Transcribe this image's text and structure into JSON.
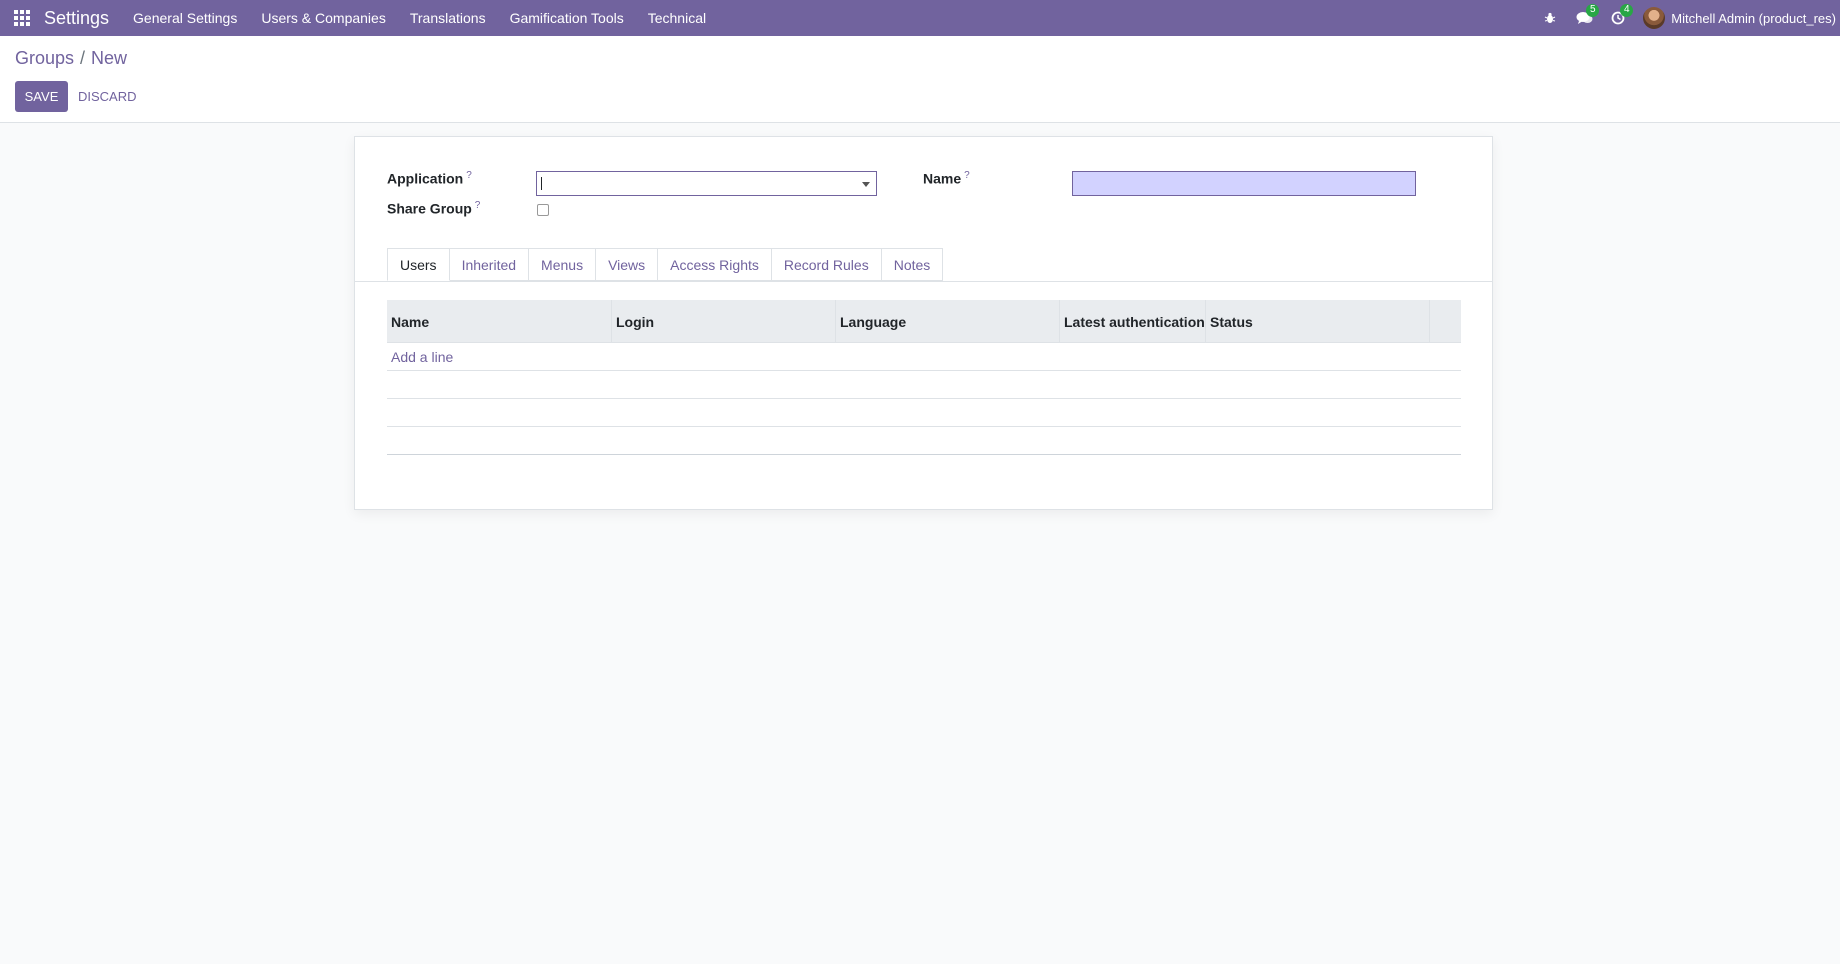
{
  "navbar": {
    "app_name": "Settings",
    "menu": [
      "General Settings",
      "Users & Companies",
      "Translations",
      "Gamification Tools",
      "Technical"
    ],
    "messages_badge": "5",
    "activities_badge": "4",
    "user": "Mitchell Admin (product_res)",
    "accent_color": "#71639e"
  },
  "breadcrumb": {
    "parent": "Groups",
    "separator": "/",
    "current": "New"
  },
  "actions": {
    "save": "SAVE",
    "discard": "DISCARD"
  },
  "form": {
    "application_label": "Application",
    "application_value": "",
    "share_group_label": "Share Group",
    "share_group_checked": false,
    "name_label": "Name",
    "name_value": "",
    "help_mark": "?"
  },
  "tabs": [
    "Users",
    "Inherited",
    "Menus",
    "Views",
    "Access Rights",
    "Record Rules",
    "Notes"
  ],
  "active_tab": "Users",
  "table": {
    "columns": [
      "Name",
      "Login",
      "Language",
      "Latest authentication",
      "Status",
      ""
    ],
    "add_line": "Add a line"
  }
}
